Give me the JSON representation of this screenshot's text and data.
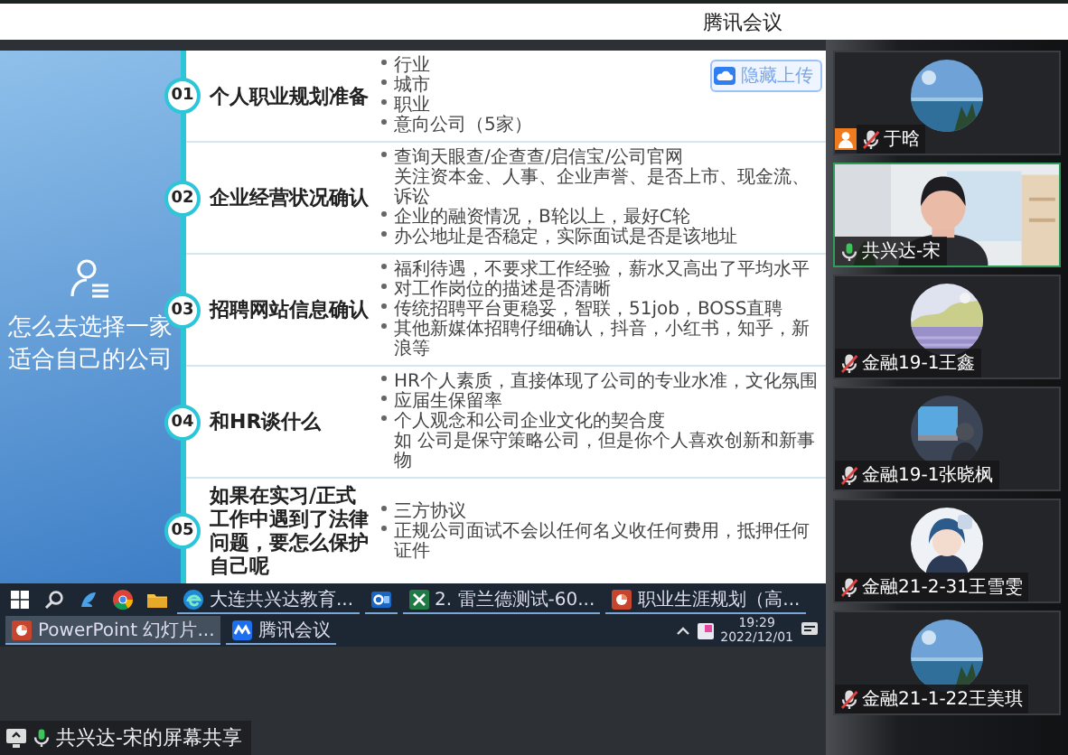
{
  "window": {
    "title": "腾讯会议"
  },
  "shared_screen": {
    "slide": {
      "heading": "怎么去选择一家适合自己的公司",
      "upload_button": "隐藏上传",
      "sections": [
        {
          "number": "01",
          "title": "个人职业规划准备",
          "points": [
            {
              "kind": "bullet",
              "text": "行业"
            },
            {
              "kind": "bullet",
              "text": "城市"
            },
            {
              "kind": "bullet",
              "text": "职业"
            },
            {
              "kind": "bullet",
              "text": "意向公司（5家）"
            }
          ]
        },
        {
          "number": "02",
          "title": "企业经营状况确认",
          "points": [
            {
              "kind": "bullet",
              "text": "查询天眼查/企查查/启信宝/公司官网"
            },
            {
              "kind": "note",
              "text": "关注资本金、人事、企业声誉、是否上市、现金流、诉讼"
            },
            {
              "kind": "bullet",
              "text": "企业的融资情况，B轮以上，最好C轮"
            },
            {
              "kind": "bullet",
              "text": "办公地址是否稳定，实际面试是否是该地址"
            }
          ]
        },
        {
          "number": "03",
          "title": "招聘网站信息确认",
          "points": [
            {
              "kind": "bullet",
              "text": "福利待遇，不要求工作经验，薪水又高出了平均水平"
            },
            {
              "kind": "bullet",
              "text": "对工作岗位的描述是否清晰"
            },
            {
              "kind": "bullet",
              "text": "传统招聘平台更稳妥，智联，51job，BOSS直聘"
            },
            {
              "kind": "bullet",
              "text": "其他新媒体招聘仔细确认，抖音，小红书，知乎，新浪等"
            }
          ]
        },
        {
          "number": "04",
          "title": "和HR谈什么",
          "points": [
            {
              "kind": "bullet",
              "text": "HR个人素质，直接体现了公司的专业水准，文化氛围"
            },
            {
              "kind": "bullet",
              "text": "应届生保留率"
            },
            {
              "kind": "bullet",
              "text": "个人观念和公司企业文化的契合度"
            },
            {
              "kind": "note",
              "text": "如  公司是保守策略公司，但是你个人喜欢创新和新事物"
            }
          ]
        },
        {
          "number": "05",
          "title": "如果在实习/正式工作中遇到了法律问题，要怎么保护自己呢",
          "points": [
            {
              "kind": "bullet",
              "text": "三方协议"
            },
            {
              "kind": "bullet",
              "text": "正规公司面试不会以任何名义收任何费用，抵押任何证件"
            }
          ]
        }
      ]
    },
    "taskbar": {
      "items": [
        {
          "kind": "windows"
        },
        {
          "kind": "search"
        },
        {
          "kind": "assistant"
        },
        {
          "kind": "chrome"
        },
        {
          "kind": "folder"
        },
        {
          "kind": "edge",
          "label": "大连共兴达教育...",
          "selected": false
        },
        {
          "kind": "outlook",
          "selected": false
        },
        {
          "kind": "excel",
          "label": "2. 雷兰德测试-60...",
          "selected": false
        },
        {
          "kind": "powerpoint",
          "label": "职业生涯规划（高...",
          "selected": false
        },
        {
          "kind": "powerpoint",
          "label": "PowerPoint 幻灯片...",
          "selected": true
        },
        {
          "kind": "meeting",
          "label": "腾讯会议",
          "selected": false
        }
      ],
      "time": "19:29",
      "date": "2022/12/01"
    }
  },
  "share_label": "共兴达-宋的屏幕共享",
  "participants": [
    {
      "name": "于晗",
      "muted": true,
      "host": true,
      "video": false,
      "speaking": false
    },
    {
      "name": "共兴达-宋",
      "muted": false,
      "host": false,
      "video": true,
      "speaking": true
    },
    {
      "name": "金融19-1王鑫",
      "muted": true,
      "host": false,
      "video": false,
      "speaking": false
    },
    {
      "name": "金融19-1张晓枫",
      "muted": true,
      "host": false,
      "video": false,
      "speaking": false
    },
    {
      "name": "金融21-2-31王雪雯",
      "muted": true,
      "host": false,
      "video": false,
      "speaking": false
    },
    {
      "name": "金融21-1-22王美琪",
      "muted": true,
      "host": false,
      "video": false,
      "speaking": false
    }
  ]
}
